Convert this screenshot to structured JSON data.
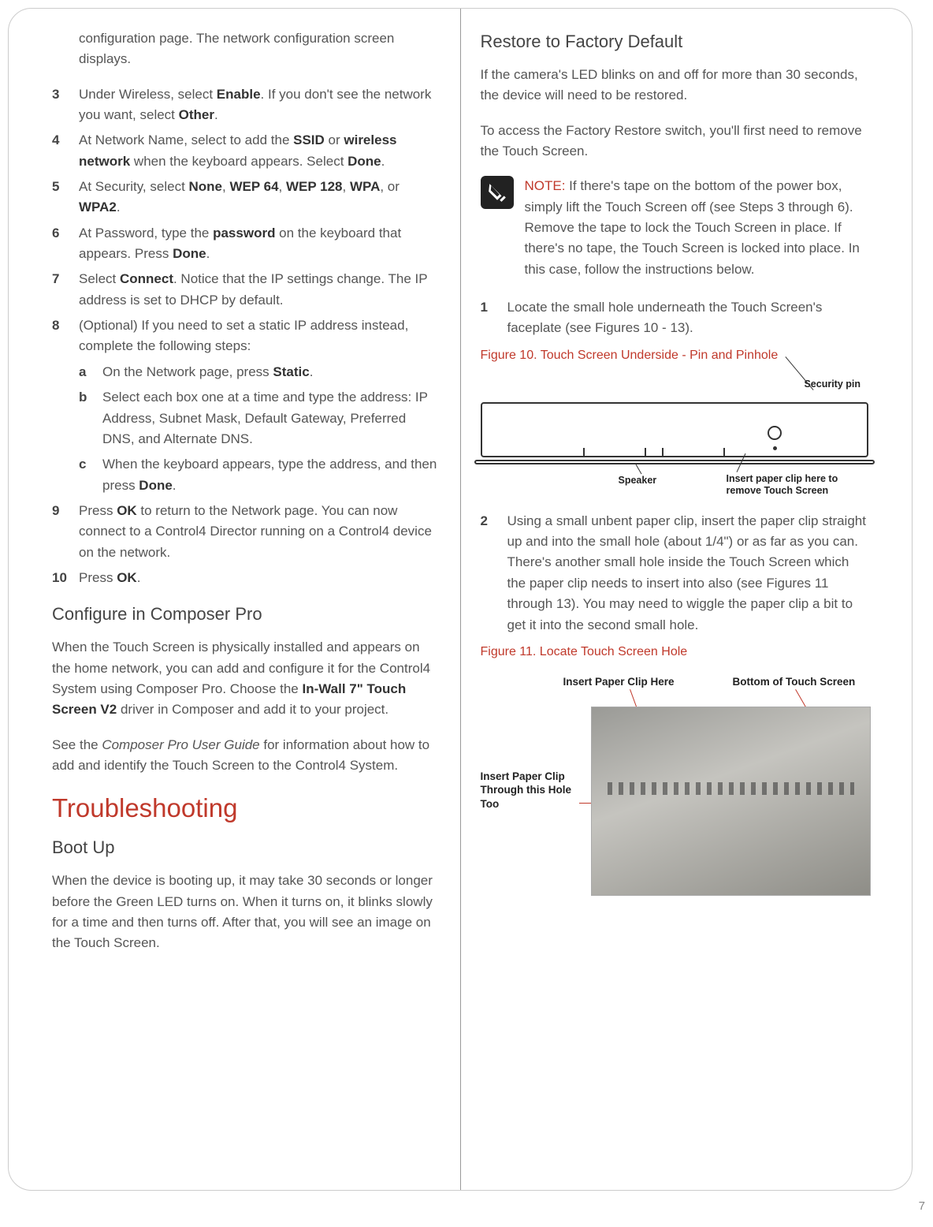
{
  "page_number": "7",
  "left": {
    "intro": "configuration page. The network configuration screen displays.",
    "steps": {
      "n3": "3",
      "t3a": "Under Wireless, select ",
      "t3b": "Enable",
      "t3c": ". If you don't see the network you want, select ",
      "t3d": "Other",
      "t3e": ".",
      "n4": "4",
      "t4a": "At Network Name, select to add the ",
      "t4b": "SSID",
      "t4c": " or ",
      "t4d": "wireless network",
      "t4e": " when the keyboard appears. Select ",
      "t4f": "Done",
      "t4g": ".",
      "n5": "5",
      "t5a": "At Security, select ",
      "t5b": "None",
      "t5c": ", ",
      "t5d": "WEP 64",
      "t5e": ", ",
      "t5f": "WEP 128",
      "t5g": ", ",
      "t5h": "WPA",
      "t5i": ", or ",
      "t5j": "WPA2",
      "t5k": ".",
      "n6": "6",
      "t6a": "At Password, type the ",
      "t6b": "password",
      "t6c": " on the keyboard that appears. Press ",
      "t6d": "Done",
      "t6e": ".",
      "n7": "7",
      "t7a": "Select ",
      "t7b": "Connect",
      "t7c": ". Notice that the IP settings change. The IP address is set to DHCP by default.",
      "n8": "8",
      "t8": "(Optional) If you need to set a static IP address instead, complete the following steps:",
      "sa": "a",
      "ta1": "On the Network page, press ",
      "ta2": "Static",
      "ta3": ".",
      "sb": "b",
      "tb": "Select each box one at a time and type the address: IP Address, Subnet Mask, Default Gateway, Preferred DNS, and Alternate DNS.",
      "sc": "c",
      "tc1": "When the keyboard appears, type the address, and then press ",
      "tc2": "Done",
      "tc3": ".",
      "n9": "9",
      "t9a": "Press ",
      "t9b": "OK",
      "t9c": " to return to the Network page. You can now connect to a Control4 Director running on a Control4 device on the network.",
      "n10": "10",
      "t10a": "Press ",
      "t10b": "OK",
      "t10c": "."
    },
    "h_compose": "Configure in Composer Pro",
    "p_compose1a": "When the Touch Screen is physically installed and appears on the home network, you can add and configure it for the Control4 System using Composer Pro.  Choose the ",
    "p_compose1b": "In-Wall 7\" Touch Screen V2",
    "p_compose1c": " driver in Composer and add it to your project.",
    "p_compose2a": "See the ",
    "p_compose2b": "Composer Pro User Guide",
    "p_compose2c": " for information about how to add and identify the Touch Screen to the Control4 System.",
    "h_trouble": "Troubleshooting",
    "h_boot": "Boot Up",
    "p_boot": "When the device is booting up, it may take 30 seconds or longer before the Green LED turns on. When it turns on, it blinks slowly for a time and then turns off. After that, you will see an image on the Touch Screen."
  },
  "right": {
    "h_restore": "Restore to Factory Default",
    "p_r1": "If the camera's LED blinks on and off for more than 30 seconds, the device will need to be restored.",
    "p_r2": "To access the Factory Restore switch, you'll first need to remove the Touch Screen.",
    "note_prefix": "NOTE:",
    "note_body": " If there's tape on the bottom of the power box, simply lift the Touch Screen off (see Steps 3 through 6). Remove the tape to lock the Touch Screen in place. If there's no tape, the Touch Screen is locked into place. In this case, follow the instructions below.",
    "n1": "1",
    "t1": "Locate the small hole underneath the Touch Screen's faceplate (see Figures 10 - 13).",
    "fig10_cap": "Figure 10. Touch Screen Underside - Pin and Pinhole",
    "fig10_sec": "Security pin",
    "fig10_spk": "Speaker",
    "fig10_ins": "Insert paper clip here to remove Touch Screen",
    "n2": "2",
    "t2": "Using a small unbent paper clip, insert the paper clip straight up and into the small hole (about 1/4\") or as far as you can. There's another small hole inside the Touch Screen which the paper clip needs to insert into also (see Figures 11 through 13). You may need to wiggle the paper clip a bit to get it into the second small hole.",
    "fig11_cap": "Figure 11. Locate Touch Screen Hole",
    "fig11_top1": "Insert Paper Clip Here",
    "fig11_top2": "Bottom of Touch Screen",
    "fig11_left": "Insert Paper Clip Through this Hole Too"
  }
}
